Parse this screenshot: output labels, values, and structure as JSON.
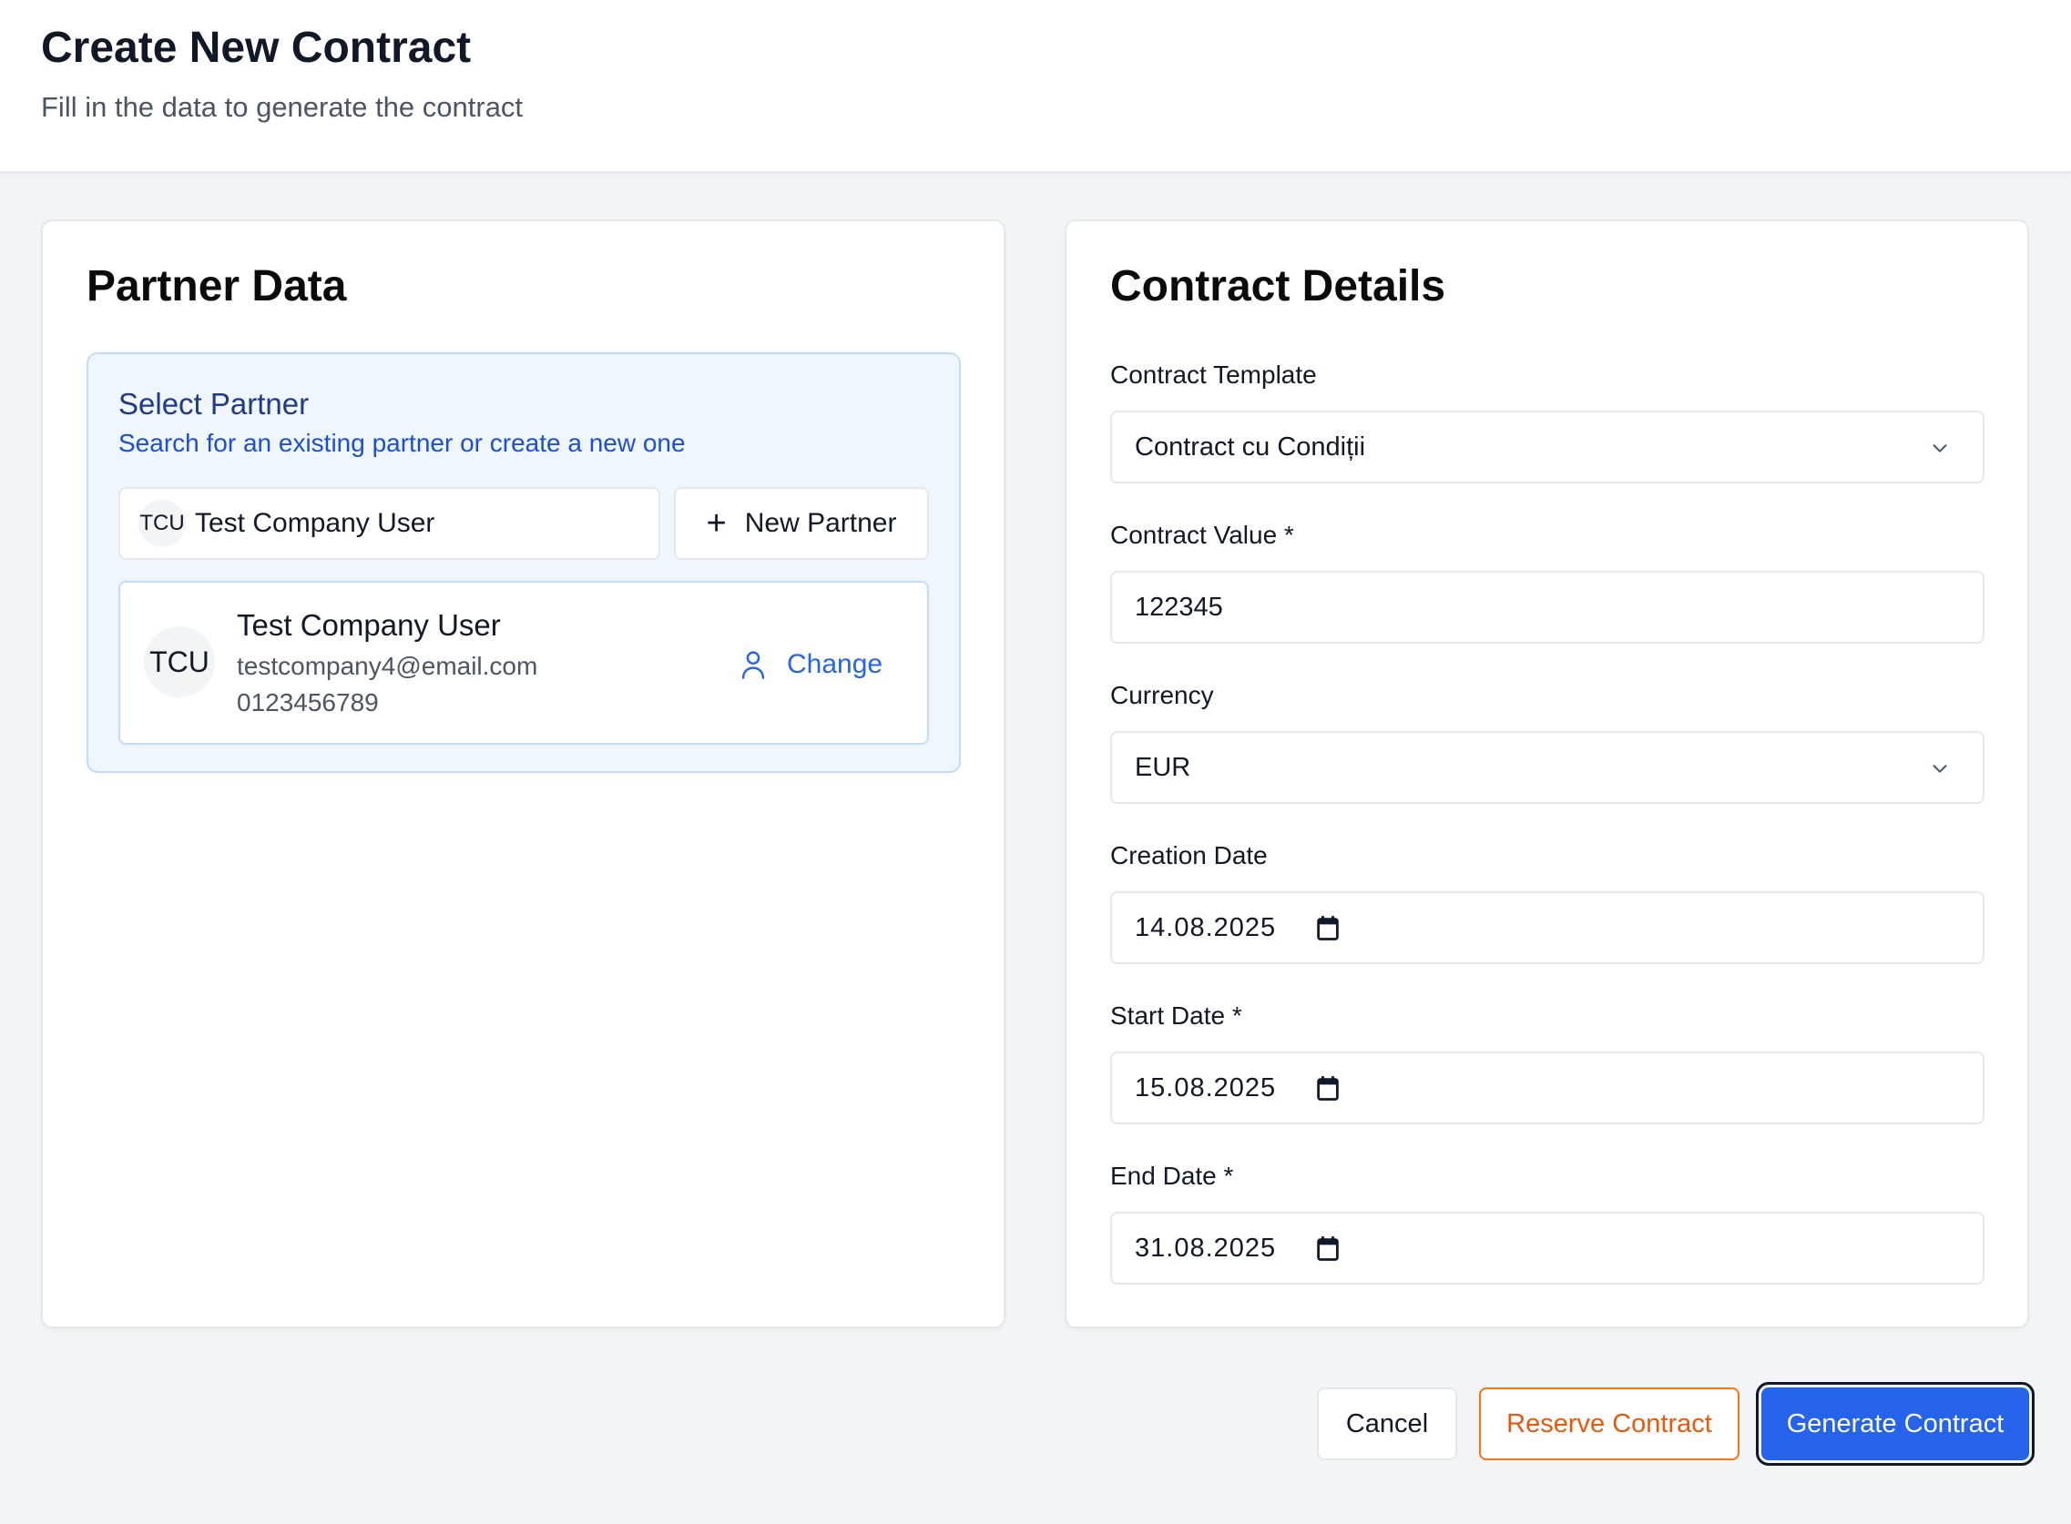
{
  "header": {
    "title": "Create New Contract",
    "subtitle": "Fill in the data to generate the contract"
  },
  "partner": {
    "card_title": "Partner Data",
    "select_title": "Select Partner",
    "select_hint": "Search for an existing partner or create a new one",
    "search": {
      "avatar": "TCU",
      "value": "Test Company User"
    },
    "new_partner_label": "New Partner",
    "selected": {
      "avatar": "TCU",
      "name": "Test Company User",
      "email": "testcompany4@email.com",
      "phone": "0123456789",
      "change_label": "Change"
    }
  },
  "contract": {
    "card_title": "Contract Details",
    "template": {
      "label": "Contract Template",
      "value": "Contract cu Condiții"
    },
    "value": {
      "label": "Contract Value *",
      "value": "122345"
    },
    "currency": {
      "label": "Currency",
      "value": "EUR"
    },
    "creation_date": {
      "label": "Creation Date",
      "value": "14.08.2025"
    },
    "start_date": {
      "label": "Start Date *",
      "value": "15.08.2025"
    },
    "end_date": {
      "label": "End Date *",
      "value": "31.08.2025"
    }
  },
  "actions": {
    "cancel": "Cancel",
    "reserve": "Reserve Contract",
    "generate": "Generate Contract"
  },
  "icons": {
    "plus": "plus-icon",
    "user": "user-icon",
    "chevron": "chevron-down-icon",
    "calendar": "calendar-icon"
  },
  "colors": {
    "primary": "#2563eb",
    "reserve": "#ea580c",
    "panel_bg": "#eff6ff",
    "panel_border": "#bfdbfe"
  }
}
